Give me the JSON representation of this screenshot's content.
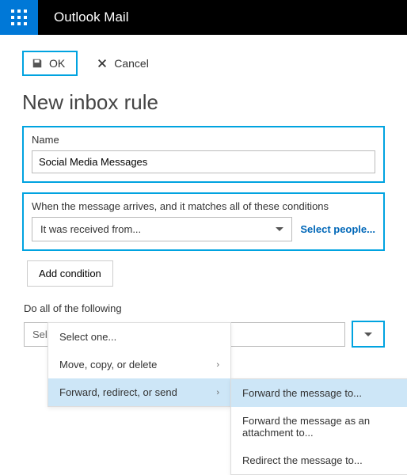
{
  "header": {
    "app_title": "Outlook Mail"
  },
  "actions": {
    "ok_label": "OK",
    "cancel_label": "Cancel"
  },
  "page": {
    "title": "New inbox rule"
  },
  "name_section": {
    "label": "Name",
    "value": "Social Media Messages"
  },
  "condition_section": {
    "label": "When the message arrives, and it matches all of these conditions",
    "selected": "It was received from...",
    "select_people": "Select people...",
    "add_condition": "Add condition"
  },
  "action_section": {
    "label": "Do all of the following",
    "placeholder": "Select one..."
  },
  "action_menu": {
    "items": [
      {
        "label": "Select one...",
        "has_sub": false
      },
      {
        "label": "Move, copy, or delete",
        "has_sub": true
      },
      {
        "label": "Forward, redirect, or send",
        "has_sub": true
      }
    ],
    "hovered_index": 2
  },
  "action_submenu": {
    "items": [
      "Forward the message to...",
      "Forward the message as an attachment to...",
      "Redirect the message to..."
    ],
    "hovered_index": 0
  }
}
